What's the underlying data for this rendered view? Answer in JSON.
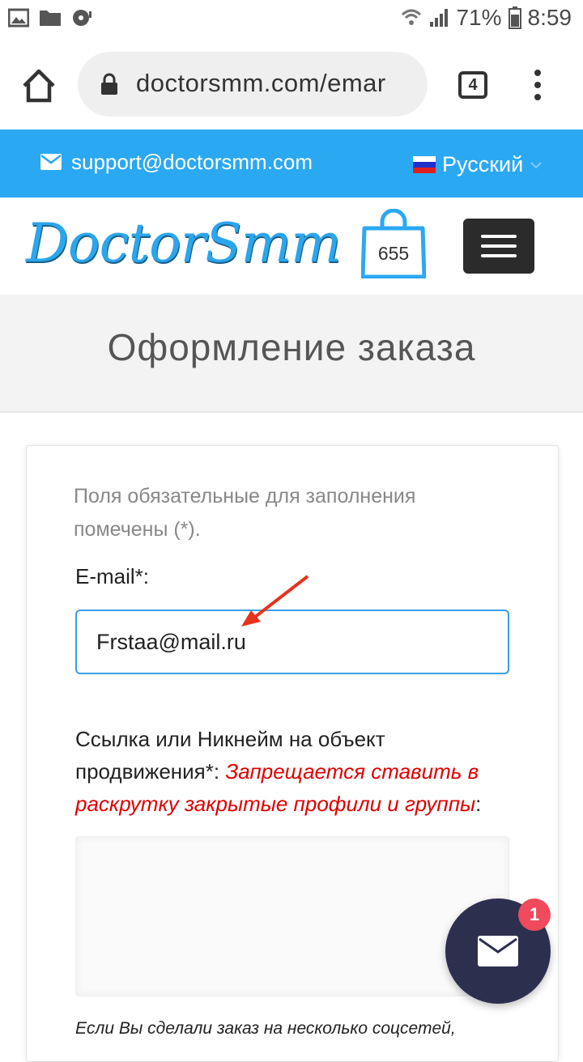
{
  "status_bar": {
    "battery": "71%",
    "time": "8:59",
    "left_icons": [
      "image-icon",
      "folder-icon",
      "media-icon"
    ],
    "right_icons": [
      "wifi-icon",
      "signal-icon",
      "battery-icon"
    ]
  },
  "browser": {
    "url": "doctorsmm.com/emar",
    "tab_count": "4"
  },
  "top_strip": {
    "email": "support@doctorsmm.com",
    "language": "Русский",
    "bg_color": "#2ba8f2"
  },
  "header": {
    "logo_text": "DoctorSmm",
    "cart_count": "655"
  },
  "page": {
    "title": "Оформление заказа"
  },
  "form": {
    "hint": "Поля обязательные для заполнения помечены (*).",
    "email_label": "E-mail*:",
    "email_value": "Frstaa@mail.ru",
    "link_label": "Ссылка или Никнейм на объект продвижения*: ",
    "link_warning": "Запрещается ставить в раскрутку закрытые профили и группы",
    "link_label_end": ":",
    "note": "Если Вы сделали заказ на несколько соцсетей,"
  },
  "chat": {
    "badge": "1"
  }
}
